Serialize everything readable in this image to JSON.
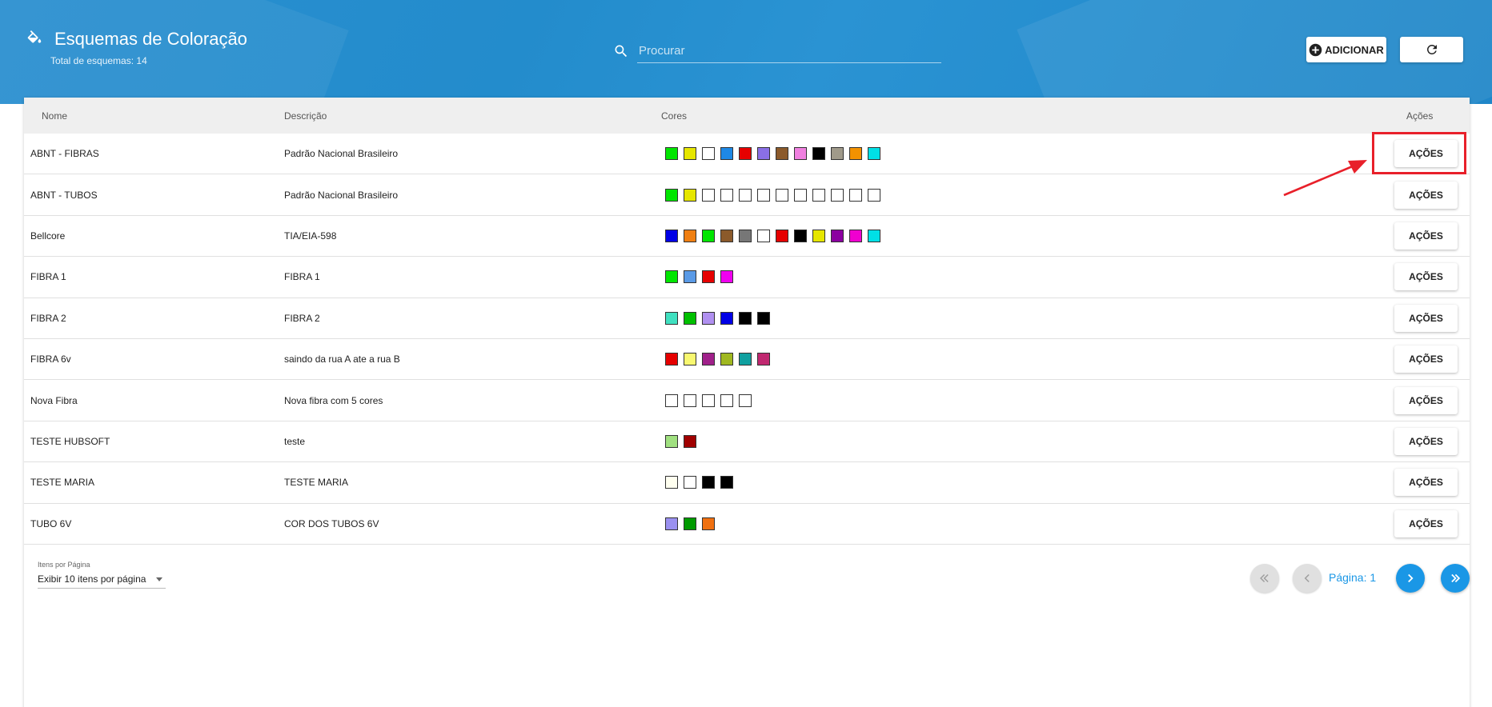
{
  "header": {
    "title": "Esquemas de Coloração",
    "subtitle": "Total de esquemas: 14",
    "search_placeholder": "Procurar",
    "add_label": "ADICIONAR"
  },
  "table": {
    "columns": {
      "name": "Nome",
      "description": "Descrição",
      "colors": "Cores",
      "actions": "Ações"
    },
    "action_label": "AÇÕES",
    "rows": [
      {
        "name": "ABNT - FIBRAS",
        "description": "Padrão Nacional Brasileiro",
        "colors": [
          "#00e600",
          "#e6e600",
          "#ffffff",
          "#1e88e5",
          "#e60000",
          "#8a6fe6",
          "#8b5a2b",
          "#f080e0",
          "#000000",
          "#a09a8a",
          "#f39200",
          "#00e0e6"
        ]
      },
      {
        "name": "ABNT - TUBOS",
        "description": "Padrão Nacional Brasileiro",
        "colors": [
          "#00e600",
          "#e6e600",
          "#ffffff",
          "#ffffff",
          "#ffffff",
          "#ffffff",
          "#ffffff",
          "#ffffff",
          "#ffffff",
          "#ffffff",
          "#ffffff",
          "#ffffff"
        ]
      },
      {
        "name": "Bellcore",
        "description": "TIA/EIA-598",
        "colors": [
          "#0000e6",
          "#f07f12",
          "#00e600",
          "#8b5a2b",
          "#777777",
          "#ffffff",
          "#e60000",
          "#000000",
          "#e6e600",
          "#8b00a0",
          "#f000d0",
          "#00e0e6"
        ]
      },
      {
        "name": "FIBRA 1",
        "description": "FIBRA 1",
        "colors": [
          "#00e600",
          "#5a9ae6",
          "#e60000",
          "#f000f0"
        ]
      },
      {
        "name": "FIBRA 2",
        "description": "FIBRA 2",
        "colors": [
          "#40e0c0",
          "#00c000",
          "#b090f0",
          "#0000e6",
          "#000000",
          "#000000"
        ]
      },
      {
        "name": "FIBRA 6v",
        "description": "saindo da rua A ate a rua B",
        "colors": [
          "#e60000",
          "#f8f870",
          "#a0208a",
          "#a0b820",
          "#10a0a0",
          "#c02870"
        ]
      },
      {
        "name": "Nova Fibra",
        "description": "Nova fibra com 5 cores",
        "colors": [
          "#ffffff",
          "#ffffff",
          "#ffffff",
          "#ffffff",
          "#ffffff"
        ]
      },
      {
        "name": "TESTE HUBSOFT",
        "description": "teste",
        "colors": [
          "#a0e080",
          "#a00000"
        ]
      },
      {
        "name": "TESTE MARIA",
        "description": "TESTE MARIA",
        "colors": [
          "#fffff0",
          "#ffffff",
          "#000000",
          "#000000"
        ]
      },
      {
        "name": "TUBO 6V",
        "description": "COR DOS TUBOS 6V",
        "colors": [
          "#9a90f0",
          "#009a00",
          "#f07010"
        ]
      }
    ]
  },
  "footer": {
    "per_page_label": "Itens por Página",
    "per_page_value": "Exibir 10 itens por página",
    "page_text": "Página: 1"
  },
  "colors": {
    "header_blue": "#238ccc",
    "accent": "#1a97e6",
    "highlight": "#e8202a"
  }
}
